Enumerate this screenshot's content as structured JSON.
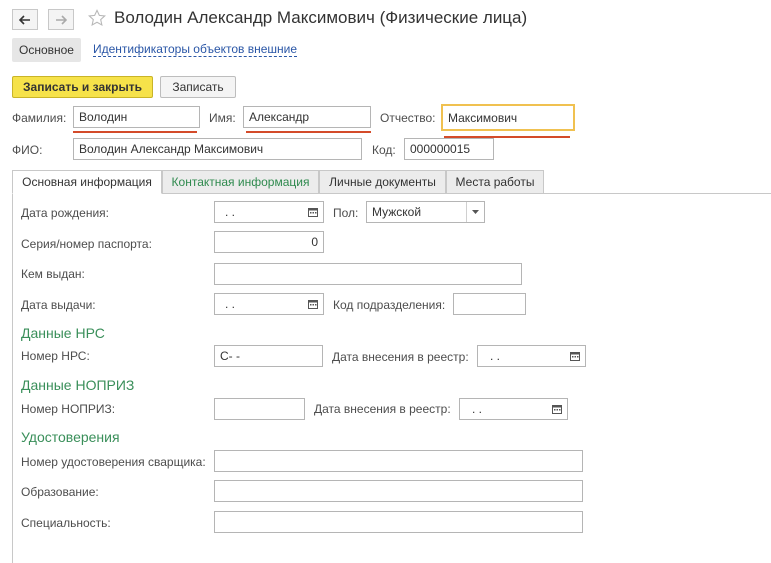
{
  "window": {
    "title": "Володин Александр Максимович (Физические лица)"
  },
  "nav": {
    "back_icon": "arrow-left-icon",
    "forward_icon": "arrow-right-icon",
    "favorite_icon": "star-icon"
  },
  "subtabs": {
    "main": "Основное",
    "link": "Идентификаторы объектов внешние"
  },
  "toolbar": {
    "save_close_label": "Записать и закрыть",
    "save_label": "Записать"
  },
  "person": {
    "lastname_label": "Фамилия:",
    "lastname_value": "Володин",
    "firstname_label": "Имя:",
    "firstname_value": "Александр",
    "middlename_label": "Отчество:",
    "middlename_value": "Максимович",
    "fullname_label": "ФИО:",
    "fullname_value": "Володин Александр Максимович",
    "code_label": "Код:",
    "code_value": "000000015"
  },
  "tabs": [
    {
      "label": "Основная информация"
    },
    {
      "label": "Контактная информация"
    },
    {
      "label": "Личные документы"
    },
    {
      "label": "Места работы"
    }
  ],
  "main": {
    "birthdate_label": "Дата рождения:",
    "birthdate_value": " .  .",
    "gender_label": "Пол:",
    "gender_value": "Мужской",
    "passport_label": "Серия/номер паспорта:",
    "passport_value": "0",
    "issued_by_label": "Кем выдан:",
    "issued_by_value": "",
    "issue_date_label": "Дата выдачи:",
    "issue_date_value": " .  .",
    "division_code_label": "Код подразделения:",
    "division_code_value": ""
  },
  "nrs": {
    "section_title": "Данные НРС",
    "number_label": "Номер НРС:",
    "number_value": "С-  -",
    "reg_date_label": "Дата внесения в реестр:",
    "reg_date_value": " .  ."
  },
  "nopriz": {
    "section_title": "Данные НОПРИЗ",
    "number_label": "Номер НОПРИЗ:",
    "number_value": "",
    "reg_date_label": "Дата внесения в реестр:",
    "reg_date_value": " .  ."
  },
  "certificates": {
    "section_title": "Удостоверения",
    "welder_label": "Номер удостоверения сварщика:",
    "welder_value": "",
    "education_label": "Образование:",
    "education_value": "",
    "specialty_label": "Специальность:",
    "specialty_value": ""
  },
  "colors": {
    "accent_button": "#f6e24a",
    "required_underline": "#d44b2a",
    "section_green": "#3a8f5a",
    "link_blue": "#2a56a6",
    "focus_border": "#f0c150"
  }
}
